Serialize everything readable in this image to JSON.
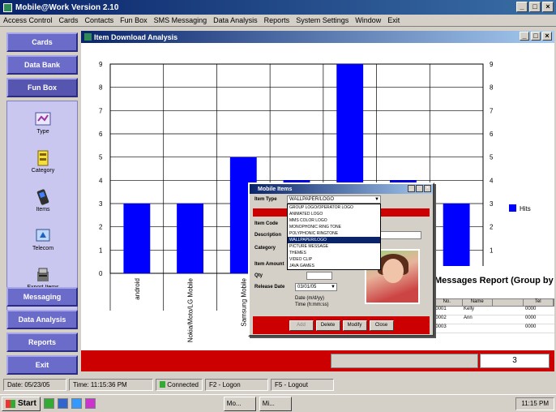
{
  "window": {
    "title": "Mobile@Work Version 2.10"
  },
  "menu": [
    "Access Control",
    "Cards",
    "Contacts",
    "Fun Box",
    "SMS Messaging",
    "Data Analysis",
    "Reports",
    "System Settings",
    "Window",
    "Exit"
  ],
  "sidebar": {
    "top_buttons": [
      "Cards",
      "Data Bank",
      "Fun Box"
    ],
    "icons": [
      {
        "label": "Type",
        "icon": "type-icon"
      },
      {
        "label": "Category",
        "icon": "category-icon"
      },
      {
        "label": "Items",
        "icon": "items-icon"
      },
      {
        "label": "Telecom",
        "icon": "telecom-icon"
      },
      {
        "label": "Export Items",
        "icon": "export-items-icon"
      }
    ],
    "bottom_buttons": [
      "Messaging",
      "Data Analysis",
      "Reports",
      "Exit"
    ]
  },
  "mdi": {
    "title": "Item Download Analysis"
  },
  "chart_data": {
    "type": "bar",
    "categories": [
      "android",
      "Nokia/Moto/LG Mobile",
      "Samsung Mobile",
      "",
      "",
      "",
      ""
    ],
    "values": [
      3,
      3,
      5,
      4,
      9,
      4,
      3
    ],
    "ylim": [
      0,
      9
    ],
    "yticks": [
      0,
      1,
      2,
      3,
      4,
      5,
      6,
      7,
      8,
      9
    ],
    "grid": true,
    "legend": {
      "position": "right",
      "entries": [
        "Hits"
      ]
    },
    "color": "#0000ff"
  },
  "report": {
    "title": "Messages Report (Group by D",
    "columns": [
      "No.",
      "Name",
      "",
      "Tel"
    ],
    "rows": [
      [
        "00001",
        "Kelly",
        "",
        "0000"
      ],
      [
        "00002",
        "Ann",
        "",
        "0000"
      ],
      [
        "00003",
        "",
        "",
        "0000"
      ]
    ]
  },
  "counter": {
    "value": "3"
  },
  "dialog": {
    "title": "Mobile Items",
    "item_type_label": "Item Type",
    "item_type_value": "WALLPAPER/LOGO",
    "options": [
      "GROUP LOGO/OPERATOR LOGO",
      "ANIMATED LOGO",
      "MMS COLOR LOGO",
      "MONOPHONIC RING TONE",
      "POLYPHONIC RINGTONE",
      "WALLPAPER/LOGO",
      "PICTURE MESSAGE",
      "THEMES",
      "VIDEO CLIP",
      "JAVA GAMES"
    ],
    "selected_option": 5,
    "fields": {
      "item_code": "Item Code",
      "description": "Description",
      "category": "Category",
      "item_amount": "Item Amount",
      "qty": "Qty",
      "release_date": "Release Date",
      "release_date_value": "03/01/05",
      "date_info": "Date (m/d/yy)",
      "time_info": "Time (h:mm:ss)"
    },
    "buttons": [
      "Add",
      "Delete",
      "Modify",
      "Close"
    ]
  },
  "status": {
    "date": "Date: 05/23/05",
    "time": "Time: 11:15:36 PM",
    "connection": "Connected",
    "f2": "F2 - Logon",
    "f5": "F5 - Logout"
  },
  "taskbar": {
    "start": "Start",
    "tasks": [
      "Mo...",
      "Mi..."
    ],
    "clock": "11:15 PM"
  }
}
